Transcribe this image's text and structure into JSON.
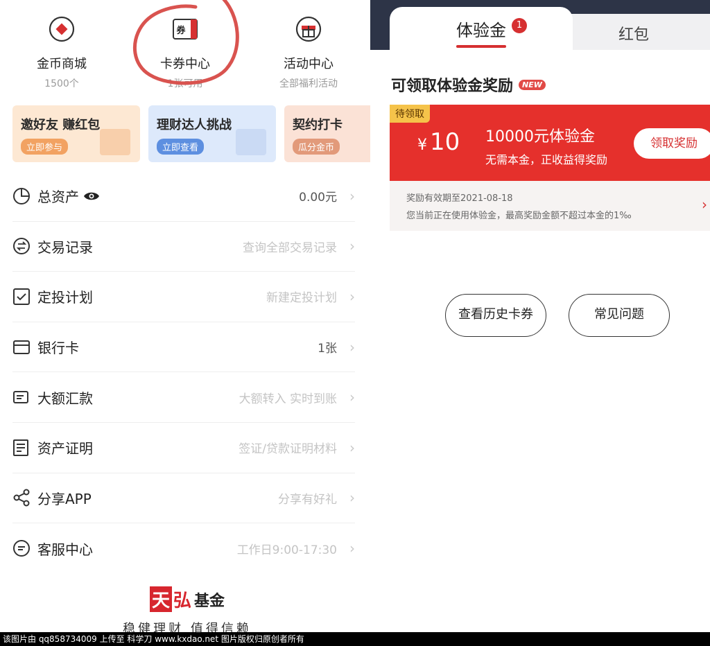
{
  "left": {
    "top_icons": [
      {
        "icon": "gold-coin-shop-icon",
        "title": "金币商城",
        "sub": "1500个"
      },
      {
        "icon": "coupon-ticket-icon",
        "icon_text": "券",
        "title": "卡券中心",
        "sub": "1张可用"
      },
      {
        "icon": "gift-box-icon",
        "title": "活动中心",
        "sub": "全部福利活动"
      }
    ],
    "banners": [
      {
        "title": "邀好友 赚红包",
        "button": "立即参与"
      },
      {
        "title": "理财达人挑战",
        "button": "立即查看"
      },
      {
        "title": "契约打卡",
        "button": "瓜分金币"
      }
    ],
    "menu": [
      {
        "icon": "pie-chart-icon",
        "label": "总资产",
        "value": "0.00元",
        "has_eye": true
      },
      {
        "icon": "exchange-icon",
        "label": "交易记录",
        "value": "查询全部交易记录"
      },
      {
        "icon": "checkbox-icon",
        "label": "定投计划",
        "value": "新建定投计划"
      },
      {
        "icon": "bank-card-icon",
        "label": "银行卡",
        "value": "1张"
      },
      {
        "icon": "transfer-icon",
        "label": "大额汇款",
        "value": "大额转入 实时到账"
      },
      {
        "icon": "document-icon",
        "label": "资产证明",
        "value": "签证/贷款证明材料"
      },
      {
        "icon": "share-icon",
        "label": "分享APP",
        "value": "分享有好礼"
      },
      {
        "icon": "customer-service-icon",
        "label": "客服中心",
        "value": "工作日9:00-17:30"
      }
    ],
    "logo": {
      "mark": "天",
      "mark2": "弘",
      "name": "基金",
      "slogan": "稳健理财 值得信赖"
    }
  },
  "right": {
    "tabs": [
      {
        "label": "体验金",
        "badge": "1"
      },
      {
        "label": "红包"
      }
    ],
    "section_title": "可领取体验金奖励",
    "new_badge": "NEW",
    "card": {
      "status": "待领取",
      "currency": "¥",
      "amount": "10",
      "title": "10000元体验金",
      "desc": "无需本金，正收益得奖励",
      "button": "领取奖励",
      "valid": "奖励有效期至2021-08-18",
      "note": "您当前正在使用体验金，最高奖励金额不超过本金的1‰"
    },
    "buttons": [
      "查看历史卡券",
      "常见问题"
    ]
  },
  "footer": "该图片由 qq858734009 上传至 科学刀 www.kxdao.net 图片版权归原创者所有",
  "colors": {
    "accent_red": "#e5302c",
    "tab_bg": "#2d3447",
    "pending_yellow": "#f5c34a"
  }
}
